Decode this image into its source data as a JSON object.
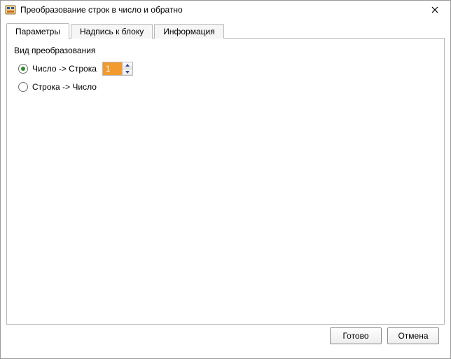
{
  "window": {
    "title": "Преобразование строк в число и обратно"
  },
  "tabs": {
    "parameters": "Параметры",
    "caption": "Надпись к блоку",
    "info": "Информация",
    "active": "parameters"
  },
  "panel": {
    "section_label": "Вид преобразования",
    "options": {
      "num_to_str": "Число -> Строка",
      "str_to_num": "Строка -> Число",
      "selected": "num_to_str"
    },
    "spinner_value": "1"
  },
  "buttons": {
    "ok": "Готово",
    "cancel": "Отмена"
  },
  "colors": {
    "accent_orange": "#f29a2e",
    "radio_green": "#2f8a2f"
  }
}
